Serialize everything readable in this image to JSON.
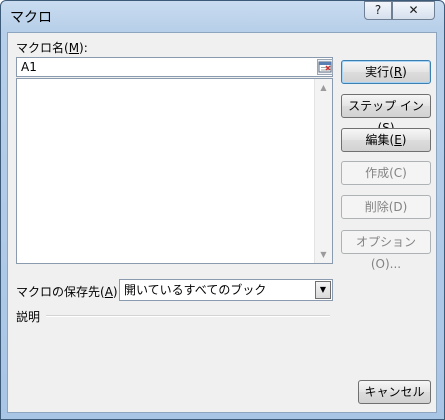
{
  "window": {
    "title": "マクロ",
    "help_label": "?",
    "close_label": "✕"
  },
  "macro_name": {
    "label_text": "マクロ名(",
    "label_key": "M",
    "label_tail": "):",
    "value": "A1"
  },
  "buttons": {
    "run": {
      "text": "実行(",
      "key": "R",
      "tail": ")"
    },
    "step_in": {
      "text": "ステップ イン(",
      "key": "S",
      "tail": ")"
    },
    "edit": {
      "text": "編集(",
      "key": "E",
      "tail": ")"
    },
    "create": "作成(C)",
    "delete": "削除(D)",
    "options": "オプション(O)...",
    "cancel": "キャンセル"
  },
  "macros_in": {
    "label_text": "マクロの保存先(",
    "label_key": "A",
    "label_tail": "):",
    "selected": "開いているすべてのブック"
  },
  "description": {
    "label": "説明"
  },
  "colors": {
    "default_button_border": "#3c7fb1",
    "title_gradient": "#b7cfe9"
  },
  "icons": [
    "help-icon",
    "close-icon",
    "collapse-dialog-icon",
    "scroll-up-icon",
    "scroll-down-icon",
    "dropdown-arrow-icon"
  ]
}
